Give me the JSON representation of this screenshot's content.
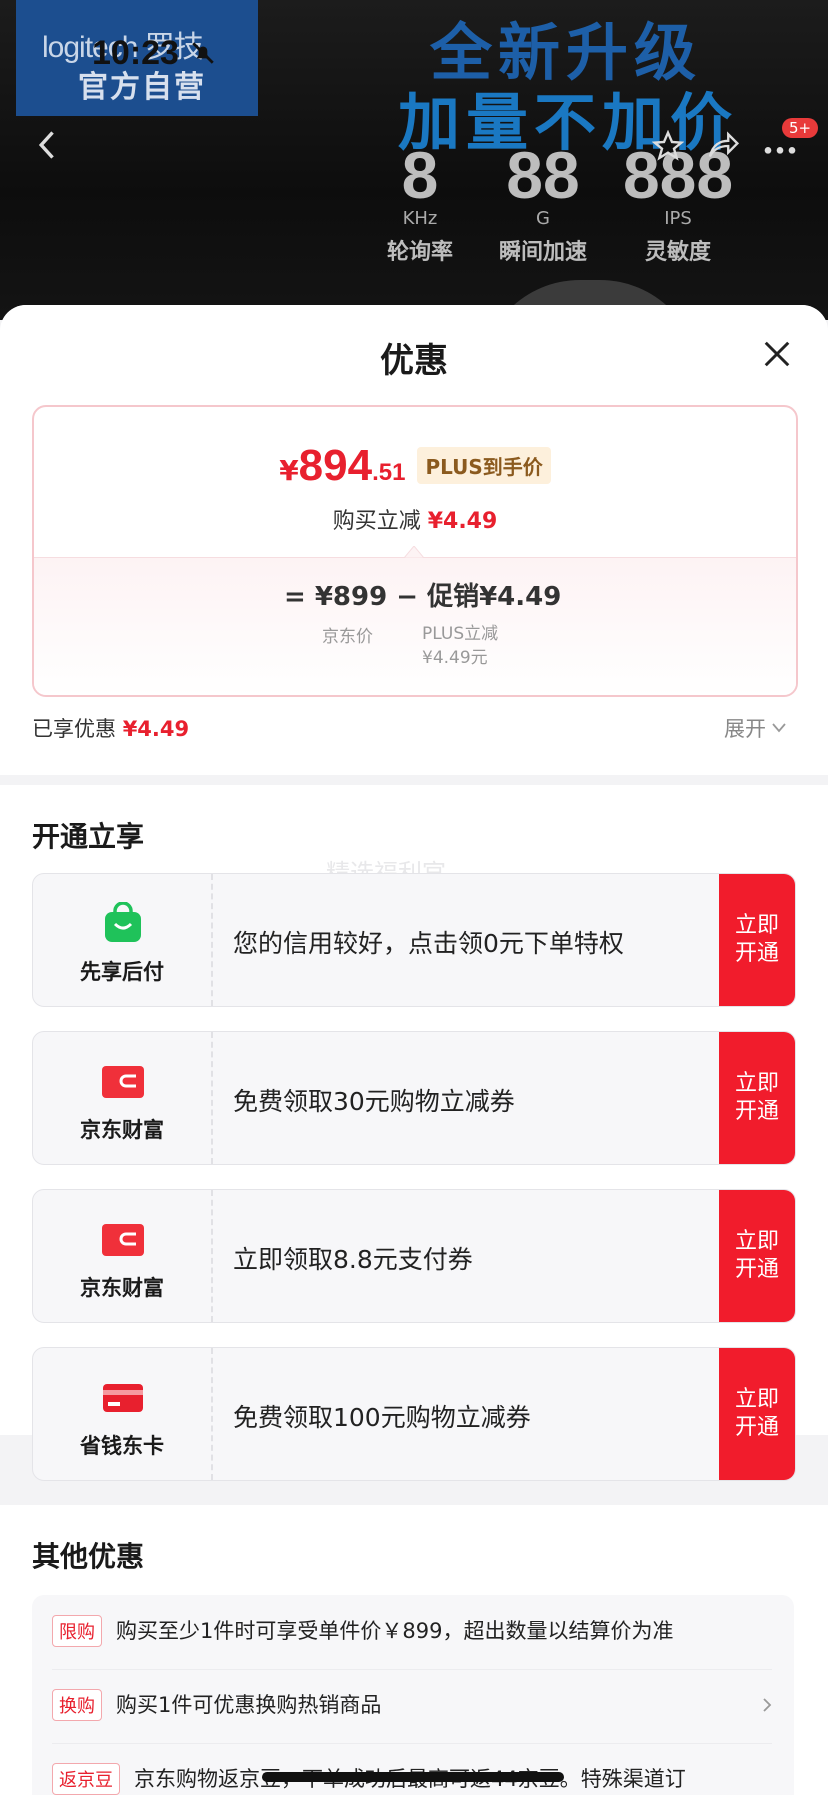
{
  "banner": {
    "logo_text": "logitech 罗技",
    "logo_sub": "官方自营",
    "time": "10:23",
    "headline1": "全新升级",
    "headline2": "加量不加价",
    "stats": [
      {
        "num": "8",
        "unit": "KHz",
        "label": "轮询率"
      },
      {
        "num": "88",
        "unit": "G",
        "label": "瞬间加速"
      },
      {
        "num": "888",
        "unit": "IPS",
        "label": "灵敏度"
      }
    ],
    "badge": "5+"
  },
  "sheet": {
    "title": "优惠",
    "price": {
      "symbol": "¥",
      "integer": "894",
      "decimal": ".51",
      "tag": "PLUS到手价",
      "reduce_label": "购买立减",
      "reduce_value": "¥4.49"
    },
    "formula": {
      "text": "= ¥899 − 促销¥4.49",
      "jd_price_label": "京东价",
      "plus_label": "PLUS立减",
      "plus_value": "¥4.49元"
    },
    "enjoyed_label": "已享优惠",
    "enjoyed_value": "¥4.49",
    "expand_label": "展开"
  },
  "open_section": {
    "title": "开通立享",
    "watermark": "精选福利官",
    "offers": [
      {
        "name": "先享后付",
        "text": "您的信用较好，点击领0元下单特权",
        "button": "立即开通",
        "icon": "shopping-bag-icon"
      },
      {
        "name": "京东财富",
        "text": "免费领取30元购物立减券",
        "button": "立即开通",
        "icon": "wallet-icon"
      },
      {
        "name": "京东财富",
        "text": "立即领取8.8元支付券",
        "button": "立即开通",
        "icon": "wallet-icon"
      },
      {
        "name": "省钱东卡",
        "text": "免费领取100元购物立减券",
        "button": "立即开通",
        "icon": "card-icon"
      }
    ]
  },
  "other_section": {
    "title": "其他优惠",
    "rows": [
      {
        "tag": "限购",
        "text": "购买至少1件时可享受单件价￥899，超出数量以结算价为准"
      },
      {
        "tag": "换购",
        "text": "购买1件可优惠换购热销商品"
      },
      {
        "tag": "返京豆",
        "text": "京东购物返京豆，下单成功后最高可返44京豆。特殊渠道订"
      }
    ]
  },
  "colors": {
    "accent_red": "#f11c2c",
    "price_red": "#e8202e",
    "banner_blue": "#1c4e8f"
  }
}
